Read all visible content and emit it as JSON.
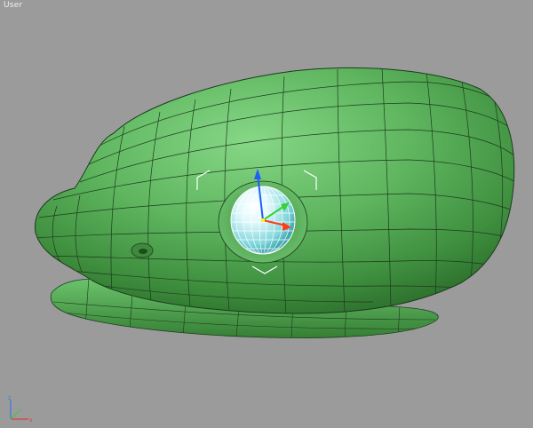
{
  "viewport": {
    "label": "User",
    "background": "#9b9b9b"
  },
  "model": {
    "name": "frog-head-mesh",
    "color": "#5fb15f",
    "selected_object": "eye-sphere",
    "wire_color": "#1c3a1c"
  },
  "gizmo": {
    "type": "move-transform-gizmo",
    "axes": [
      "x",
      "y",
      "z"
    ],
    "colors": {
      "x": "#ff3b1a",
      "y": "#36d236",
      "z": "#1f5cff"
    }
  },
  "axis_tripod": {
    "colors": {
      "x": "#e03a3a",
      "y": "#3acc3a",
      "z": "#3a7ae0"
    }
  }
}
